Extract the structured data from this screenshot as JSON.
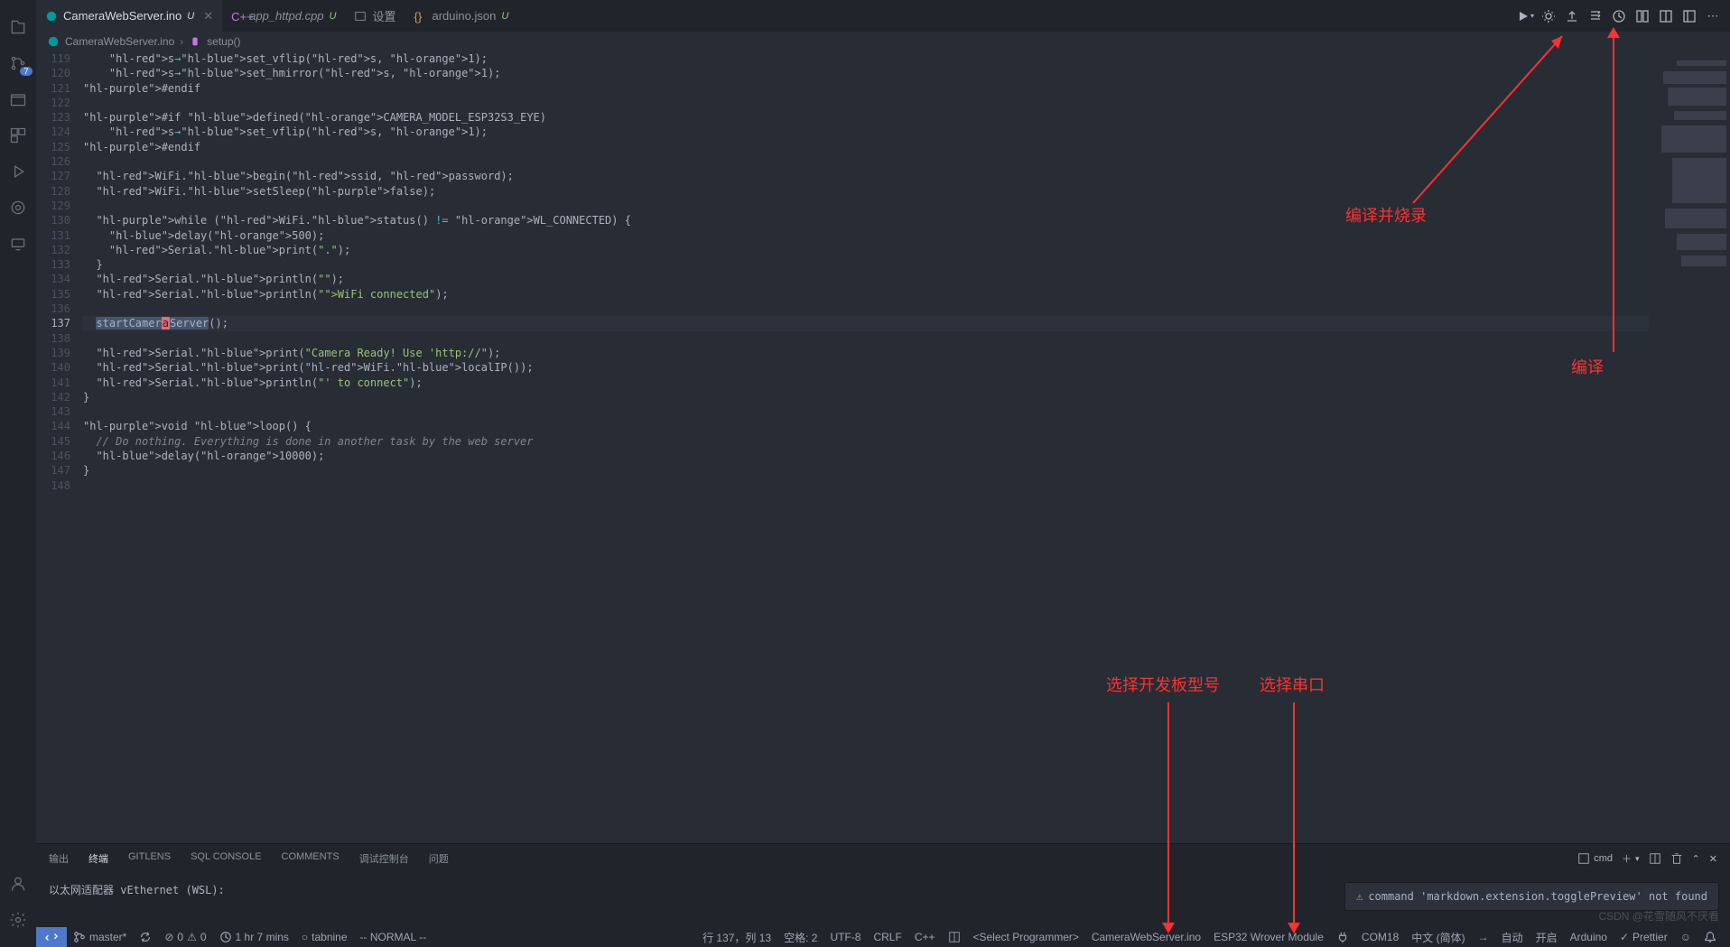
{
  "tabs": [
    {
      "label": "CameraWebServer.ino",
      "mod": "U"
    },
    {
      "label": "app_httpd.cpp",
      "mod": "U"
    },
    {
      "label": "设置"
    },
    {
      "label": "arduino.json",
      "mod": "U"
    }
  ],
  "breadcrumb": {
    "file": "CameraWebServer.ino",
    "symbol": "setup()"
  },
  "source_badge": "7",
  "code_lines": {
    "start": 119,
    "current": 137,
    "lines": [
      {
        "n": 119,
        "raw": "    s->set_vflip(s, 1);"
      },
      {
        "n": 120,
        "raw": "    s->set_hmirror(s, 1);"
      },
      {
        "n": 121,
        "raw": "#endif"
      },
      {
        "n": 122,
        "raw": ""
      },
      {
        "n": 123,
        "raw": "#if defined(CAMERA_MODEL_ESP32S3_EYE)"
      },
      {
        "n": 124,
        "raw": "    s->set_vflip(s, 1);"
      },
      {
        "n": 125,
        "raw": "#endif"
      },
      {
        "n": 126,
        "raw": ""
      },
      {
        "n": 127,
        "raw": "  WiFi.begin(ssid, password);"
      },
      {
        "n": 128,
        "raw": "  WiFi.setSleep(false);"
      },
      {
        "n": 129,
        "raw": ""
      },
      {
        "n": 130,
        "raw": "  while (WiFi.status() != WL_CONNECTED) {"
      },
      {
        "n": 131,
        "raw": "    delay(500);"
      },
      {
        "n": 132,
        "raw": "    Serial.print(\".\");"
      },
      {
        "n": 133,
        "raw": "  }"
      },
      {
        "n": 134,
        "raw": "  Serial.println(\"\");"
      },
      {
        "n": 135,
        "raw": "  Serial.println(\"WiFi connected\");"
      },
      {
        "n": 136,
        "raw": ""
      },
      {
        "n": 137,
        "raw": "  startCameraServer();"
      },
      {
        "n": 138,
        "raw": ""
      },
      {
        "n": 139,
        "raw": "  Serial.print(\"Camera Ready! Use 'http://\");"
      },
      {
        "n": 140,
        "raw": "  Serial.print(WiFi.localIP());"
      },
      {
        "n": 141,
        "raw": "  Serial.println(\"' to connect\");"
      },
      {
        "n": 142,
        "raw": "}"
      },
      {
        "n": 143,
        "raw": ""
      },
      {
        "n": 144,
        "raw": "void loop() {"
      },
      {
        "n": 145,
        "raw": "  // Do nothing. Everything is done in another task by the web server"
      },
      {
        "n": 146,
        "raw": "  delay(10000);"
      },
      {
        "n": 147,
        "raw": "}"
      },
      {
        "n": 148,
        "raw": ""
      }
    ]
  },
  "panel": {
    "tabs": [
      "输出",
      "终端",
      "GITLENS",
      "SQL CONSOLE",
      "COMMENTS",
      "调试控制台",
      "问题"
    ],
    "active": 1,
    "shell": "cmd"
  },
  "terminal_text": "以太网适配器 vEthernet (WSL):",
  "toast": {
    "message": "command 'markdown.extension.togglePreview' not found"
  },
  "status": {
    "branch": "master*",
    "sync": "",
    "errors": "0",
    "warnings": "0",
    "time": "1 hr 7 mins",
    "tabnine": "tabnine",
    "mode": "-- NORMAL --",
    "cursor": "行 137，列 13",
    "spaces": "空格: 2",
    "encoding": "UTF-8",
    "eol": "CRLF",
    "lang": "C++",
    "programmer": "<Select Programmer>",
    "sketch": "CameraWebServer.ino",
    "board": "ESP32 Wrover Module",
    "port": "COM18",
    "locale": "中文 (简体)",
    "auto_btn": "自动",
    "open_btn": "开启",
    "arduino_btn": "Arduino",
    "prettier_btn": "Prettier"
  },
  "annotations": {
    "upload": "编译并烧录",
    "compile": "编译",
    "board": "选择开发板型号",
    "port": "选择串口"
  },
  "watermark": "CSDN @花雪随风不厌看"
}
